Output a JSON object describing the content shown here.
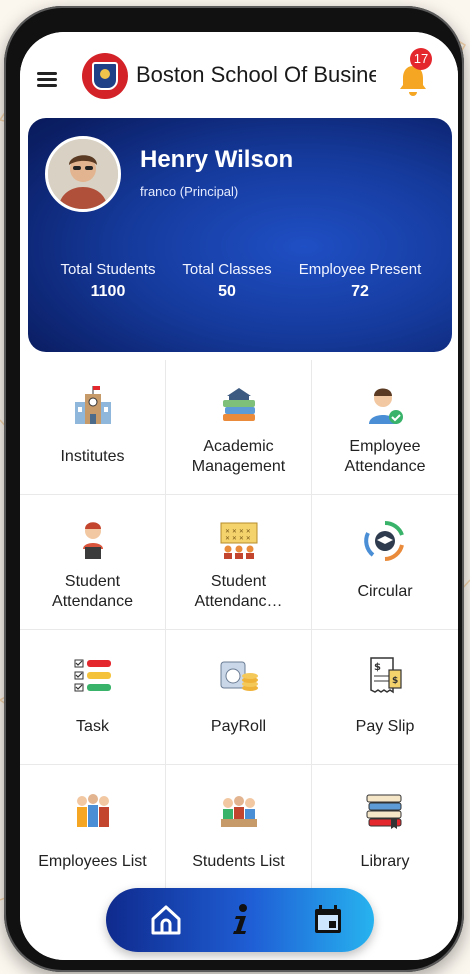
{
  "header": {
    "app_title": "Boston School Of Busines",
    "notification_count": "17",
    "brand_color": "#d32228"
  },
  "profile": {
    "name": "Henry Wilson",
    "role": "franco (Principal)",
    "stats": [
      {
        "label": "Total Students",
        "value": "1100"
      },
      {
        "label": "Total Classes",
        "value": "50"
      },
      {
        "label": "Employee Present",
        "value": "72"
      }
    ]
  },
  "menu": [
    {
      "label": "Institutes",
      "icon": "school-building-icon"
    },
    {
      "label": "Academic Management",
      "icon": "book-stack-icon"
    },
    {
      "label": "Employee Attendance",
      "icon": "employee-check-icon"
    },
    {
      "label": "Student Attendance",
      "icon": "student-podium-icon"
    },
    {
      "label": "Student Attendanc…",
      "icon": "calendar-students-icon"
    },
    {
      "label": "Circular",
      "icon": "graduation-circular-icon"
    },
    {
      "label": "Task",
      "icon": "checklist-icon"
    },
    {
      "label": "PayRoll",
      "icon": "payroll-coins-icon"
    },
    {
      "label": "Pay Slip",
      "icon": "receipt-icon"
    },
    {
      "label": "Employees List",
      "icon": "employees-group-icon"
    },
    {
      "label": "Students List",
      "icon": "students-group-icon"
    },
    {
      "label": "Library",
      "icon": "library-books-icon"
    }
  ],
  "bottom_nav": [
    "home-icon",
    "info-icon",
    "calendar-icon"
  ]
}
